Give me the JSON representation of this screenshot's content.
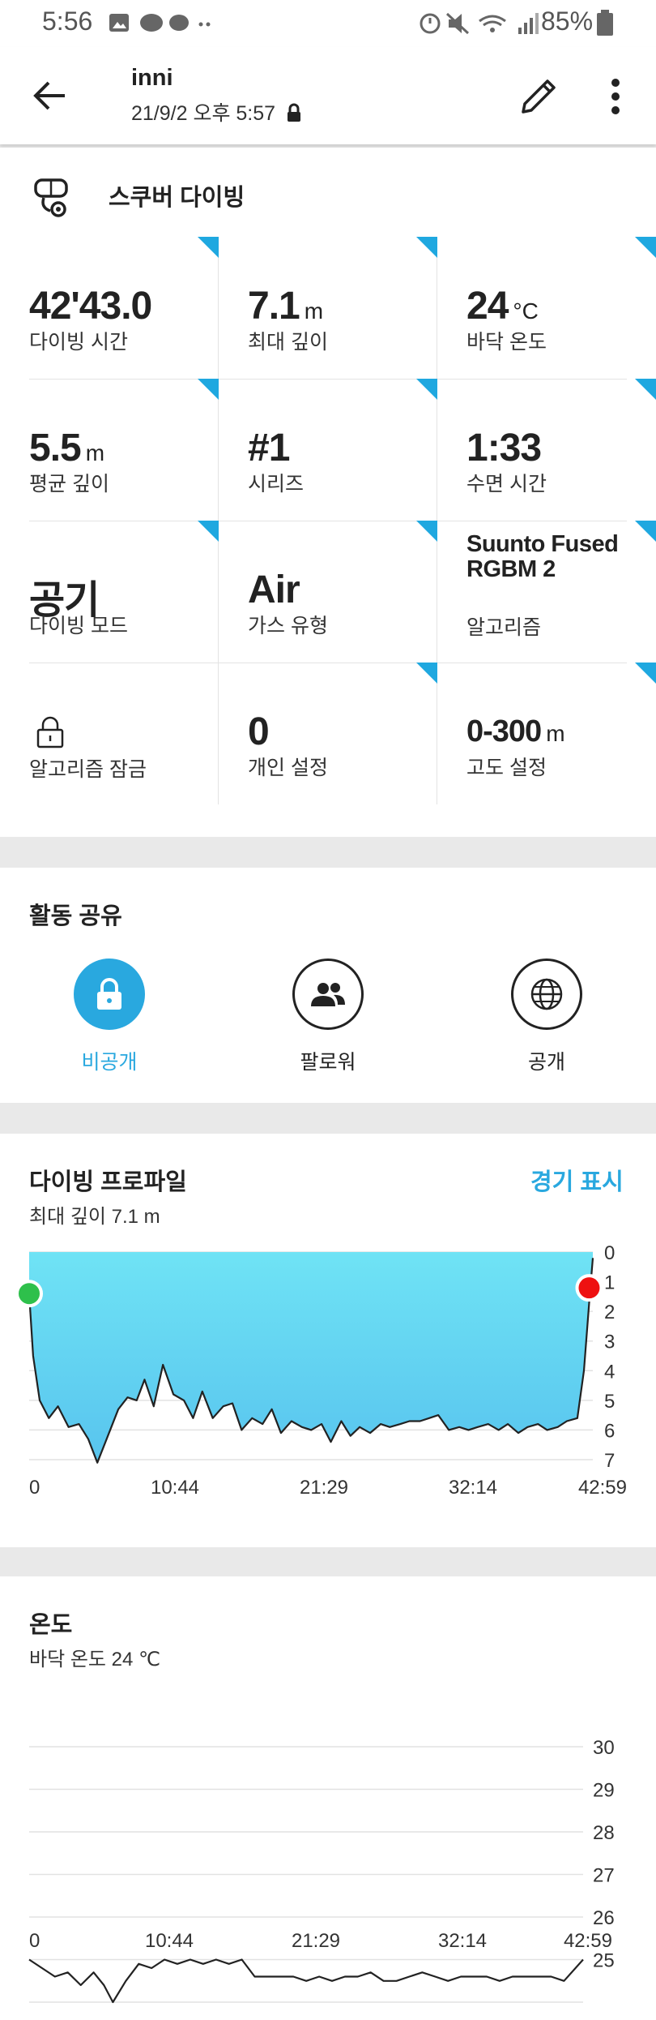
{
  "status": {
    "time": "5:56",
    "battery": "85%"
  },
  "header": {
    "title": "inni",
    "subtitle": "21/9/2 오후 5:57"
  },
  "activity": {
    "name": "스쿠버 다이빙"
  },
  "stats": [
    {
      "value": "42'43.0",
      "unit": "",
      "label": "다이빙 시간"
    },
    {
      "value": "7.1",
      "unit": "m",
      "label": "최대 깊이"
    },
    {
      "value": "24",
      "unit": "°C",
      "label": "바닥 온도"
    },
    {
      "value": "5.5",
      "unit": "m",
      "label": "평균 깊이"
    },
    {
      "value": "#1",
      "unit": "",
      "label": "시리즈"
    },
    {
      "value": "1:33",
      "unit": "",
      "label": "수면 시간"
    },
    {
      "value": "공기",
      "unit": "",
      "label": "다이빙 모드"
    },
    {
      "value": "Air",
      "unit": "",
      "label": "가스 유형"
    },
    {
      "value": "Suunto Fused RGBM 2",
      "unit": "",
      "label": "알고리즘"
    },
    {
      "value": "",
      "unit": "",
      "label": "알고리즘 잠금"
    },
    {
      "value": "0",
      "unit": "",
      "label": "개인 설정"
    },
    {
      "value": "0-300",
      "unit": "m",
      "label": "고도 설정"
    }
  ],
  "share": {
    "title": "활동 공유",
    "options": [
      {
        "label": "비공개",
        "icon": "lock-icon"
      },
      {
        "label": "팔로워",
        "icon": "followers-icon"
      },
      {
        "label": "공개",
        "icon": "globe-icon"
      }
    ],
    "active_color": "#29a8df"
  },
  "profile": {
    "title": "다이빙 프로파일",
    "link": "경기 표시",
    "subtitle": "최대 깊이 7.1 m"
  },
  "temperature": {
    "title": "온도",
    "subtitle": "바닥 온도 24 ℃"
  },
  "chart_data": [
    {
      "type": "area",
      "xticks": [
        "0",
        "10:44",
        "21:29",
        "32:14",
        "42:59"
      ],
      "x": [
        0,
        0.3,
        0.8,
        1.5,
        2.2,
        3.0,
        3.8,
        4.5,
        5.2,
        6.0,
        6.8,
        7.5,
        8.2,
        8.8,
        9.5,
        10.2,
        11.0,
        11.8,
        12.5,
        13.2,
        14.0,
        14.8,
        15.5,
        16.2,
        17.0,
        17.8,
        18.5,
        19.2,
        20.0,
        20.8,
        21.5,
        22.3,
        23.0,
        23.8,
        24.5,
        25.2,
        26.0,
        26.8,
        27.5,
        28.3,
        29.0,
        29.8,
        30.5,
        31.2,
        32.0,
        32.8,
        33.5,
        34.2,
        35.0,
        35.8,
        36.5,
        37.3,
        38.0,
        38.8,
        39.5,
        40.3,
        41.0,
        41.8,
        42.3,
        42.7,
        42.98
      ],
      "depth": [
        1.4,
        3.5,
        5.0,
        5.6,
        5.2,
        5.9,
        5.8,
        6.3,
        7.1,
        6.2,
        5.3,
        4.9,
        5.0,
        4.3,
        5.2,
        3.8,
        4.8,
        5.0,
        5.6,
        4.7,
        5.6,
        5.2,
        5.1,
        6.0,
        5.6,
        5.8,
        5.3,
        6.1,
        5.7,
        5.9,
        6.0,
        5.8,
        6.4,
        5.7,
        6.2,
        5.9,
        6.1,
        5.8,
        5.9,
        5.8,
        5.7,
        5.7,
        5.6,
        5.5,
        6.0,
        5.9,
        6.0,
        5.9,
        5.8,
        6.0,
        5.8,
        6.1,
        5.9,
        5.8,
        6.0,
        5.9,
        5.7,
        5.6,
        4.0,
        1.7,
        0.2
      ],
      "ylim": [
        0,
        7
      ],
      "yticks": [
        0,
        1,
        2,
        3,
        4,
        5,
        6,
        7
      ]
    },
    {
      "type": "line",
      "xticks": [
        "0",
        "10:44",
        "21:29",
        "32:14",
        "42:59"
      ],
      "x": [
        0,
        1.0,
        2.0,
        3.0,
        4.0,
        5.0,
        5.8,
        6.5,
        7.5,
        8.5,
        9.5,
        10.5,
        11.5,
        12.5,
        13.5,
        14.5,
        15.5,
        16.5,
        17.5,
        18.5,
        19.5,
        20.5,
        21.5,
        22.5,
        23.5,
        24.5,
        25.5,
        26.5,
        27.5,
        28.5,
        29.5,
        30.5,
        31.5,
        32.5,
        33.5,
        34.5,
        35.5,
        36.5,
        37.5,
        38.5,
        39.5,
        40.5,
        41.5,
        42.98
      ],
      "temp": [
        25.0,
        24.8,
        24.6,
        24.7,
        24.4,
        24.7,
        24.4,
        24.0,
        24.5,
        24.9,
        24.8,
        25.0,
        24.9,
        25.0,
        24.9,
        25.0,
        24.9,
        25.0,
        24.6,
        24.6,
        24.6,
        24.6,
        24.5,
        24.6,
        24.5,
        24.6,
        24.6,
        24.7,
        24.5,
        24.5,
        24.6,
        24.7,
        24.6,
        24.5,
        24.6,
        24.6,
        24.6,
        24.5,
        24.6,
        24.6,
        24.6,
        24.6,
        24.5,
        25.0
      ],
      "ylim": [
        24,
        30
      ],
      "yticks": [
        25,
        26,
        27,
        28,
        29,
        30
      ]
    }
  ]
}
